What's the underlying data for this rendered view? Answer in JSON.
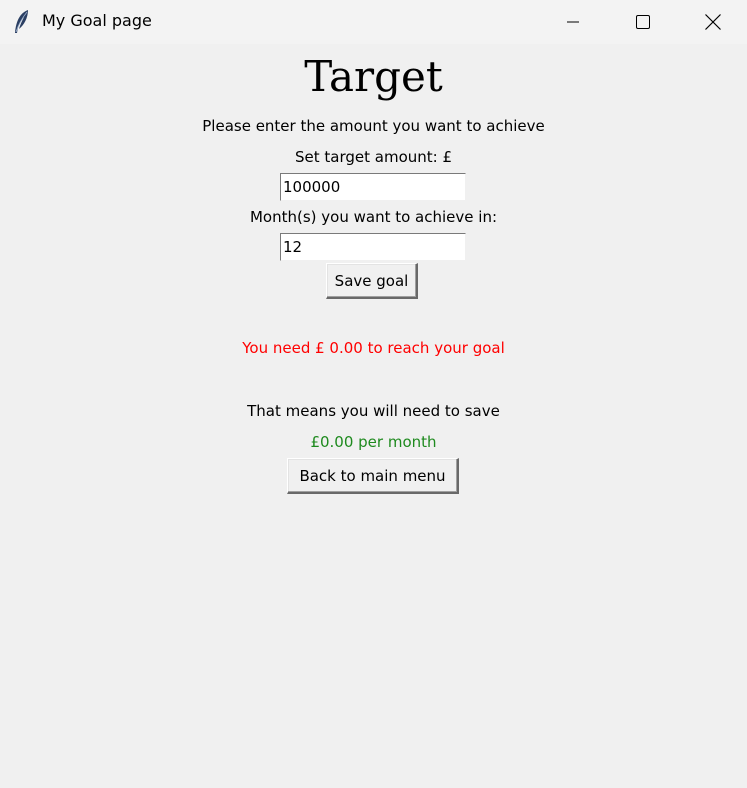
{
  "window": {
    "title": "My Goal page",
    "icon": "feather-icon"
  },
  "page": {
    "heading": "Target",
    "instruction": "Please enter the amount you want to achieve",
    "target_label": "Set target amount: £",
    "target_value": "100000",
    "months_label": "Month(s) you want to achieve in:",
    "months_value": "12",
    "save_button": "Save goal",
    "remaining_message": "You need £ 0.00 to reach your goal",
    "means_label": "That means you will need to save",
    "monthly_amount": "£0.00 per month",
    "back_button": "Back to main menu"
  },
  "colors": {
    "remaining_message": "#ff0000",
    "monthly_amount": "#1e8a1e",
    "background": "#f0f0f0"
  }
}
